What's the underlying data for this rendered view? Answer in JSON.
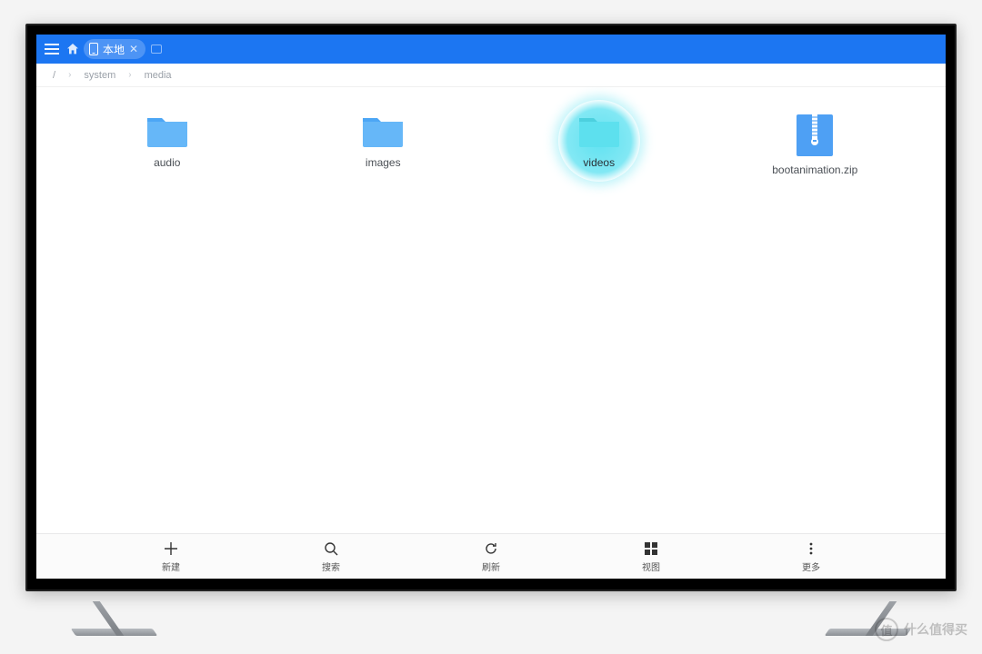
{
  "topbar": {
    "tab_label": "本地"
  },
  "breadcrumb": {
    "segments": [
      "/",
      "system",
      "media"
    ]
  },
  "items": [
    {
      "label": "audio",
      "type": "folder",
      "selected": false
    },
    {
      "label": "images",
      "type": "folder",
      "selected": false
    },
    {
      "label": "videos",
      "type": "folder",
      "selected": true
    },
    {
      "label": "bootanimation.zip",
      "type": "zip",
      "selected": false
    }
  ],
  "bottom": {
    "new": "新建",
    "search": "搜索",
    "refresh": "刷新",
    "view": "视图",
    "more": "更多"
  },
  "watermark": {
    "badge": "值",
    "text": "什么值得买"
  }
}
